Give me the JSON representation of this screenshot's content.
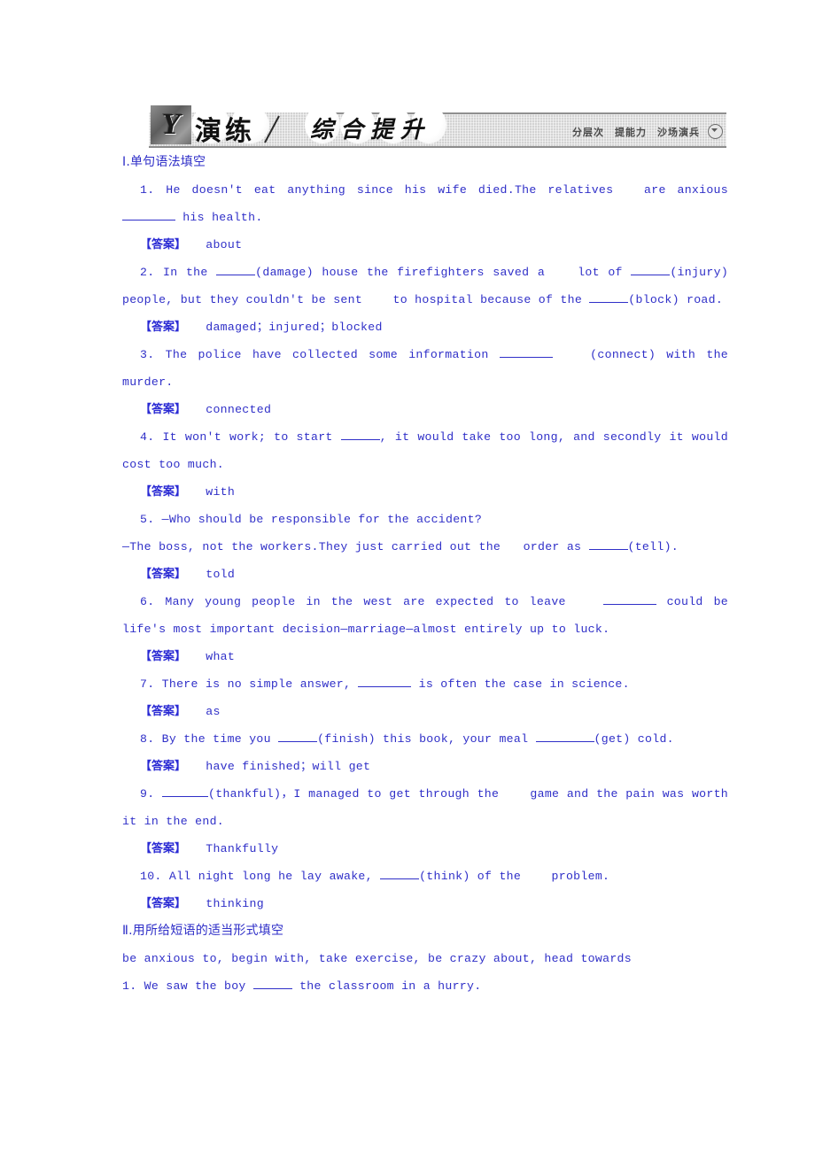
{
  "banner": {
    "badge_letter": "Y",
    "main_label": "演练",
    "sub_label": "综合提升",
    "tags": "分层次　提能力　沙场演兵",
    "chevron_icon": "chevron-down-circle-icon"
  },
  "colors": {
    "text_blue": "#2f2fc8",
    "answer_tag_blue": "#2a2ad4",
    "banner_gray": "#d3d3d3",
    "banner_border": "#8c8c8c"
  },
  "sections": [
    {
      "heading": "Ⅰ.单句语法填空",
      "answer_tag": "【答案】",
      "items": [
        {
          "number": "1.",
          "text_a": "He doesn't eat anything since his wife died.The relatives",
          "text_b": "are anxious",
          "text_c": "his health.",
          "answer": "about"
        },
        {
          "number": "2.",
          "text_a": "In the",
          "text_b": "(damage) house the firefighters saved a",
          "text_c": "lot of",
          "text_d": "(injury) people, but they couldn't be sent",
          "text_e": "to hospital because of the",
          "text_f": "(block) road.",
          "answer": "damaged；injured；blocked"
        },
        {
          "number": "3.",
          "text_a": "The police have collected some information",
          "text_b": "(connect) with the murder.",
          "answer": "connected"
        },
        {
          "number": "4.",
          "text_a": "It won't work; to start",
          "text_b": ", it would take too long, and secondly it would cost too much.",
          "answer": "with"
        },
        {
          "number": "5.",
          "text_a": "—Who should be responsible for the accident?",
          "text_b": "—The boss, not the workers.They just carried out the",
          "text_c": "order as",
          "text_d": "(tell).",
          "answer": "told"
        },
        {
          "number": "6.",
          "text_a": "Many young people in the west are expected to leave",
          "text_b": "could be life's most important decision—marriage—almost entirely up to luck.",
          "answer": "what"
        },
        {
          "number": "7.",
          "text_a": "There is no simple answer,",
          "text_b": "is often the case in science.",
          "answer": "as"
        },
        {
          "number": "8.",
          "text_a": "By the time you",
          "text_b": "(finish) this book, your meal",
          "text_c": "(get) cold.",
          "answer": "have finished；will get"
        },
        {
          "number": "9.",
          "text_a": "(thankful)，I managed to get through the",
          "text_b": "game and the pain was worth it in the end.",
          "answer": "Thankfully"
        },
        {
          "number": "10.",
          "text_a": "All night long he lay awake,",
          "text_b": "(think) of the",
          "text_c": "problem.",
          "answer": "thinking"
        }
      ]
    },
    {
      "heading": "Ⅱ.用所给短语的适当形式填空",
      "phrase_bank": "be anxious to, begin with, take exercise, be crazy about, head towards",
      "items": [
        {
          "number": "1.",
          "text_a": "We saw the boy",
          "text_b": "the classroom in a hurry."
        }
      ]
    }
  ]
}
